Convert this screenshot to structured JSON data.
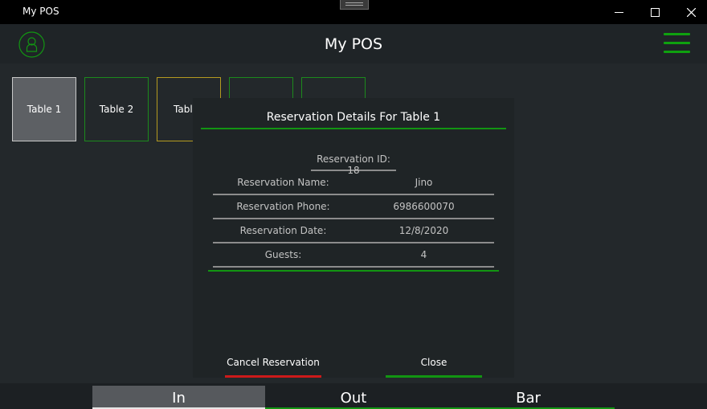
{
  "window": {
    "title": "My POS"
  },
  "appbar": {
    "title": "My POS"
  },
  "tables": [
    {
      "label": "Table 1",
      "state": "selected"
    },
    {
      "label": "Table 2",
      "state": "free"
    },
    {
      "label": "Table",
      "state": "pending"
    },
    {
      "label": "",
      "state": "free"
    },
    {
      "label": "",
      "state": "free"
    }
  ],
  "dialog": {
    "title": "Reservation Details For Table 1",
    "reservation_id": "Reservation ID: 18",
    "rows": [
      {
        "label": "Reservation Name:",
        "value": "Jino"
      },
      {
        "label": "Reservation Phone:",
        "value": "6986600070"
      },
      {
        "label": "Reservation Date:",
        "value": "12/8/2020"
      },
      {
        "label": "Guests:",
        "value": "4"
      }
    ],
    "cancel_label": "Cancel Reservation",
    "close_label": "Close"
  },
  "nav": {
    "tabs": [
      {
        "label": "In",
        "active": true
      },
      {
        "label": "Out",
        "active": false
      },
      {
        "label": "Bar",
        "active": false
      }
    ]
  },
  "colors": {
    "accent_green": "#129512",
    "danger_red": "#cc1a1a",
    "pending_yellow": "#b49a20",
    "background": "#23282b"
  },
  "icons": {
    "avatar": "user-icon",
    "menu": "hamburger-icon",
    "minimize": "minimize-icon",
    "maximize": "maximize-icon",
    "close": "close-icon"
  }
}
